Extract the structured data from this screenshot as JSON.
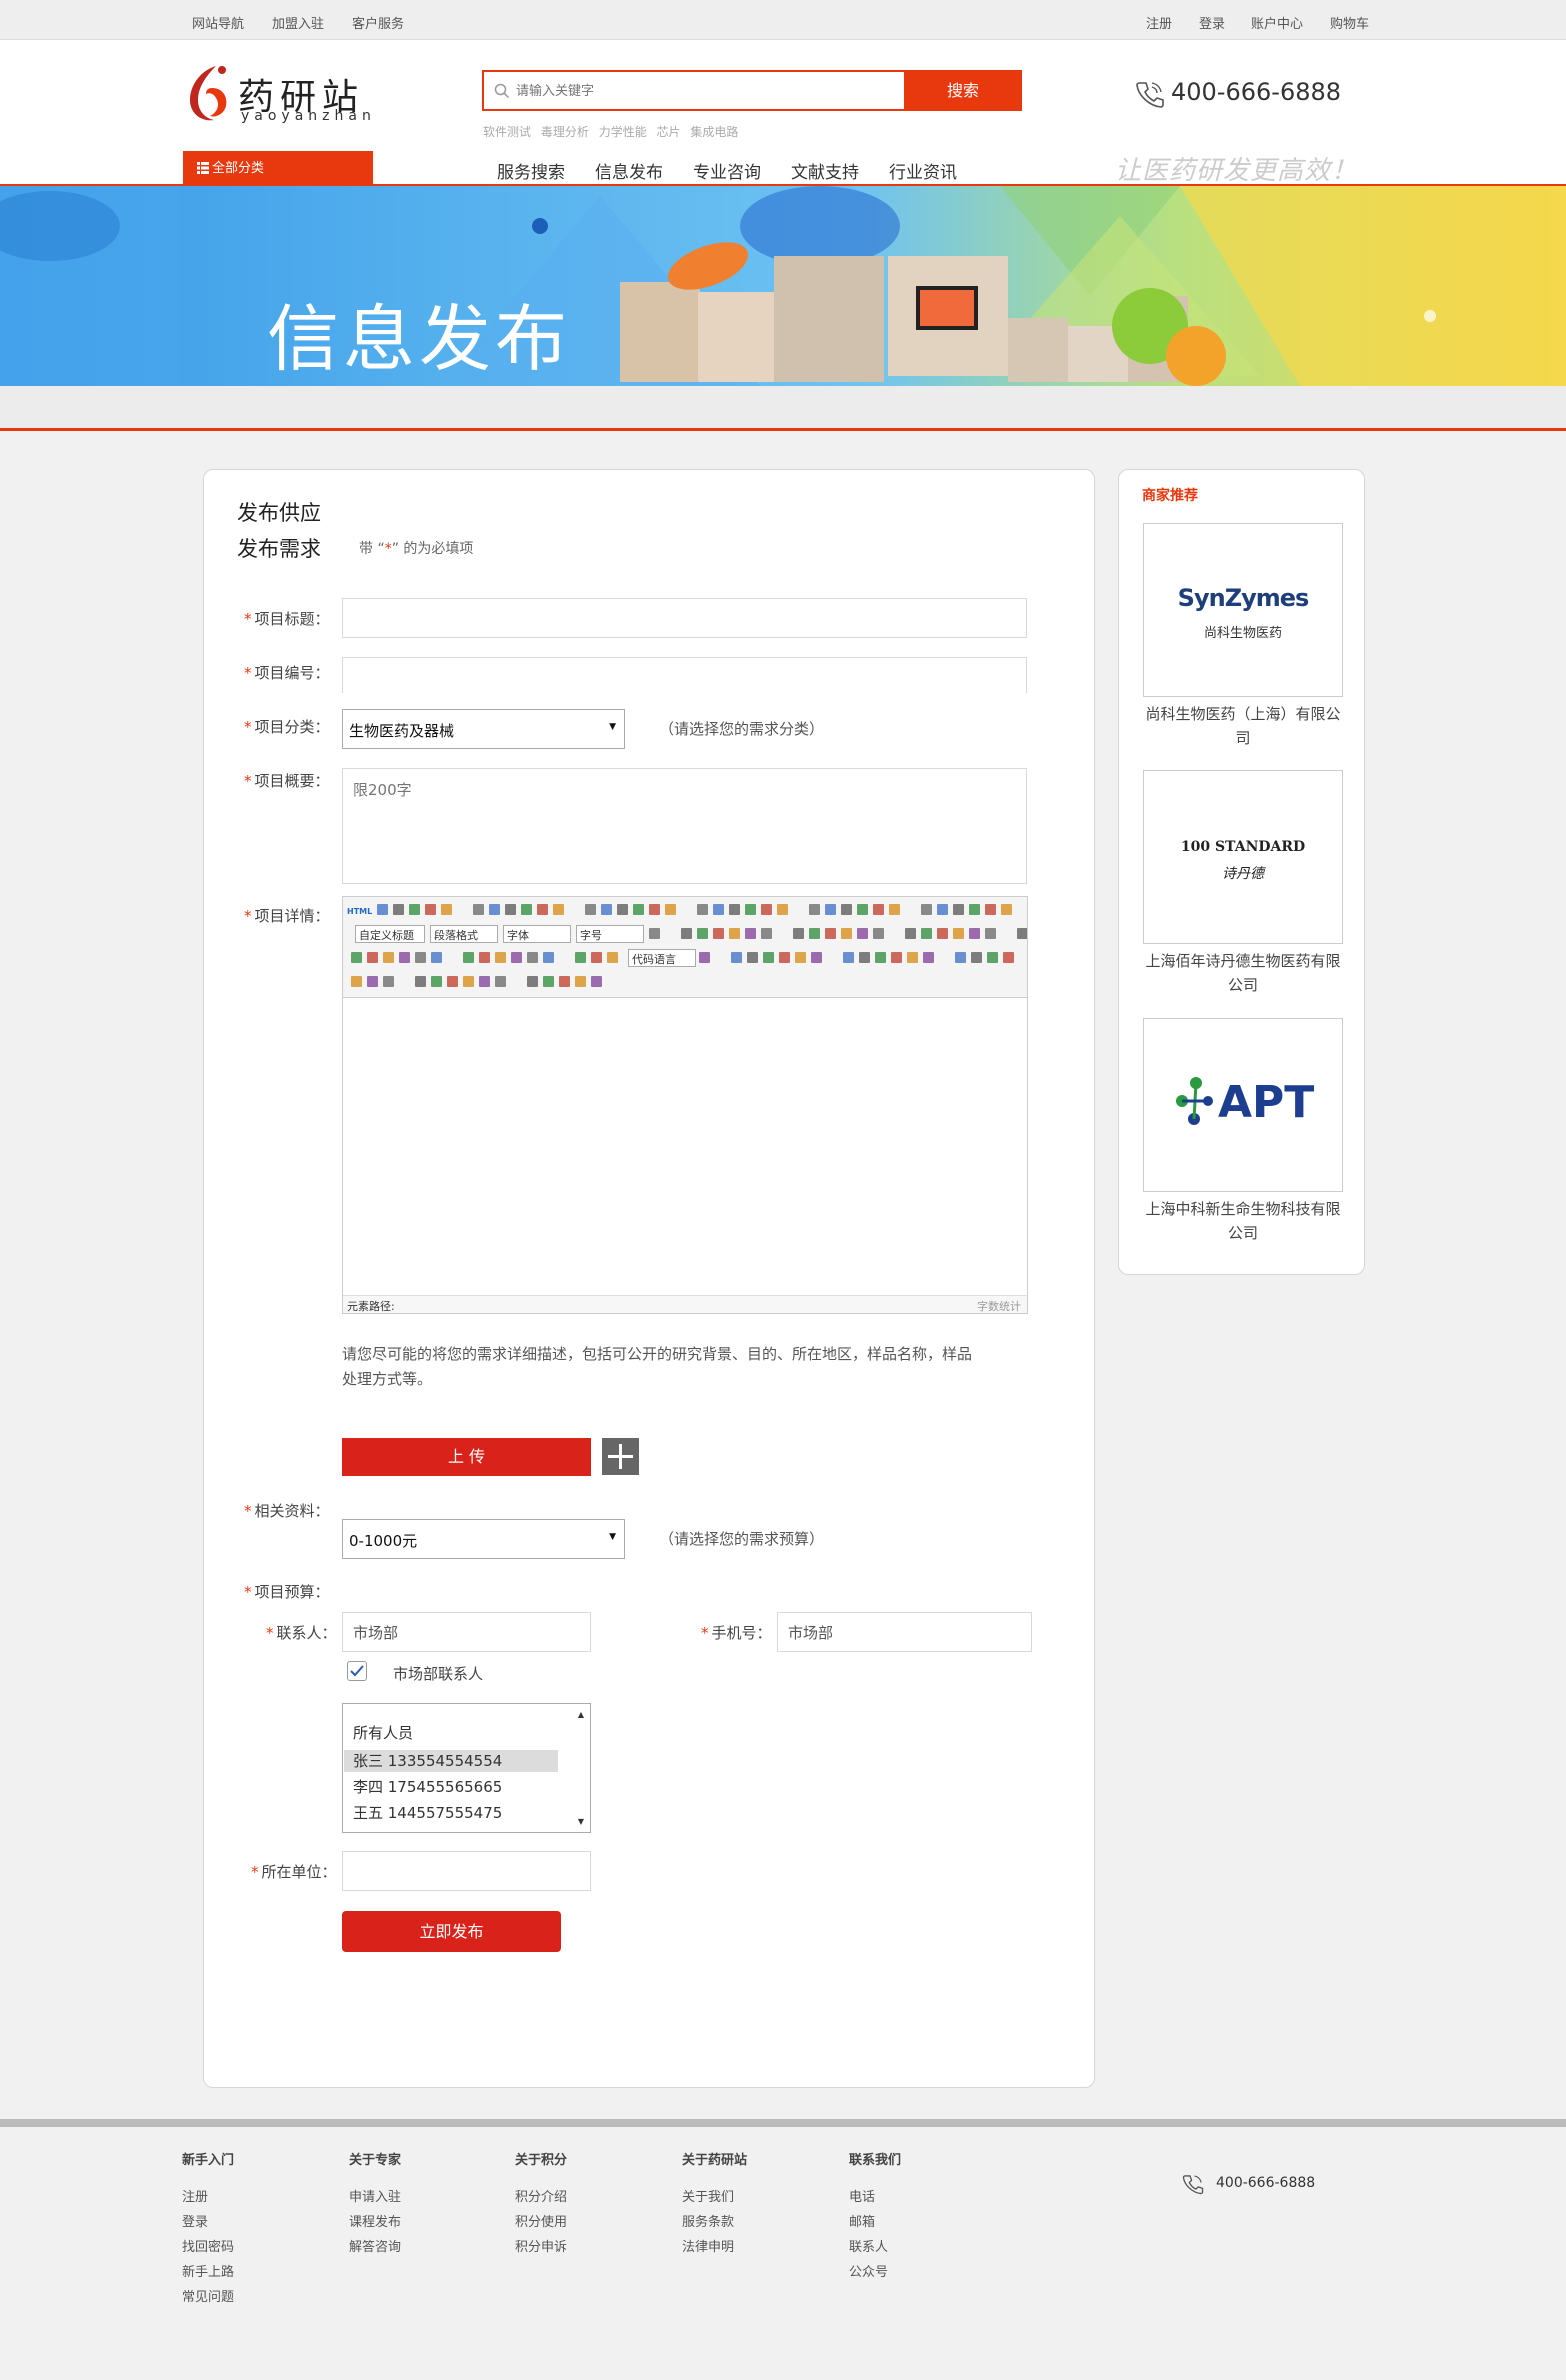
{
  "topbar": {
    "left_links": [
      "网站导航",
      "加盟入驻",
      "客户服务"
    ],
    "right_links": [
      "注册",
      "登录",
      "账户中心",
      "购物车"
    ]
  },
  "header": {
    "logo_text": "药研站",
    "logo_pinyin": "yaoyanzhan",
    "search_placeholder": "请输入关键字",
    "search_button": "搜索",
    "hot_words": [
      "软件测试",
      "毒理分析",
      "力学性能",
      "芯片",
      "集成电路"
    ],
    "phone": "400-666-6888",
    "category_button": "全部分类",
    "nav": [
      "服务搜索",
      "信息发布",
      "专业咨询",
      "文献支持",
      "行业资讯"
    ],
    "slogan": "让医药研发更高效！"
  },
  "banner": {
    "title": "信息发布"
  },
  "form": {
    "tab_supply": "发布供应",
    "tab_demand": "发布需求",
    "required_note_pre": "带 “",
    "required_note_star": "*",
    "required_note_post": "” 的为必填项",
    "label_title": "项目标题：",
    "label_code": "项目编号：",
    "label_category": "项目分类：",
    "category_value": "生物医药及器械",
    "category_hint": "（请选择您的需求分类）",
    "label_summary": "项目概要：",
    "summary_placeholder": "限200字",
    "label_detail": "项目详情：",
    "editor": {
      "row1_items": [
        "HTML"
      ],
      "row2_selects": [
        "自定义标题",
        "段落格式",
        "字体",
        "字号"
      ],
      "row3_select": "代码语言",
      "status_path": "元素路径:",
      "status_count": "字数统计"
    },
    "detail_hint": "请您尽可能的将您的需求详细描述，包括可公开的研究背景、目的、所在地区，样品名称，样品处理方式等。",
    "upload_button": "上 传",
    "label_materials": "相关资料：",
    "budget_value": "0-1000元",
    "budget_hint": "（请选择您的需求预算）",
    "label_budget": "项目预算：",
    "label_contact": "联系人：",
    "contact_value": "市场部",
    "label_mobile": "手机号：",
    "mobile_value": "市场部",
    "checkbox_label": "市场部联系人",
    "people_list": [
      "所有人员",
      "张三 133554554554",
      "李四 175455565665",
      "王五 144557555475"
    ],
    "label_unit": "所在单位：",
    "submit_button": "立即发布",
    "star": "*"
  },
  "sidebar": {
    "title": "商家推荐",
    "vendors": [
      {
        "name": "尚科生物医药（上海）有限公司",
        "logo_text": "SynZymes",
        "logo_sub": "尚科生物医药"
      },
      {
        "name": "上海佰年诗丹德生物医药有限公司",
        "logo_text": "100 STANDARD",
        "logo_sub": "诗丹德"
      },
      {
        "name": "上海中科新生命生物科技有限公司",
        "logo_text": "APT",
        "logo_sub": ""
      }
    ]
  },
  "footer": {
    "columns": [
      {
        "title": "新手入门",
        "items": [
          "注册",
          "登录",
          "找回密码",
          "新手上路",
          "常见问题"
        ]
      },
      {
        "title": "关于专家",
        "items": [
          "申请入驻",
          "课程发布",
          "解答咨询"
        ]
      },
      {
        "title": "关于积分",
        "items": [
          "积分介绍",
          "积分使用",
          "积分申诉"
        ]
      },
      {
        "title": "关于药研站",
        "items": [
          "关于我们",
          "服务条款",
          "法律申明"
        ]
      },
      {
        "title": "联系我们",
        "items": [
          "电话",
          "邮箱",
          "联系人",
          "公众号"
        ]
      }
    ],
    "phone": "400-666-6888"
  },
  "colors": {
    "brand": "#e8390e",
    "button_red": "#d9221a"
  }
}
